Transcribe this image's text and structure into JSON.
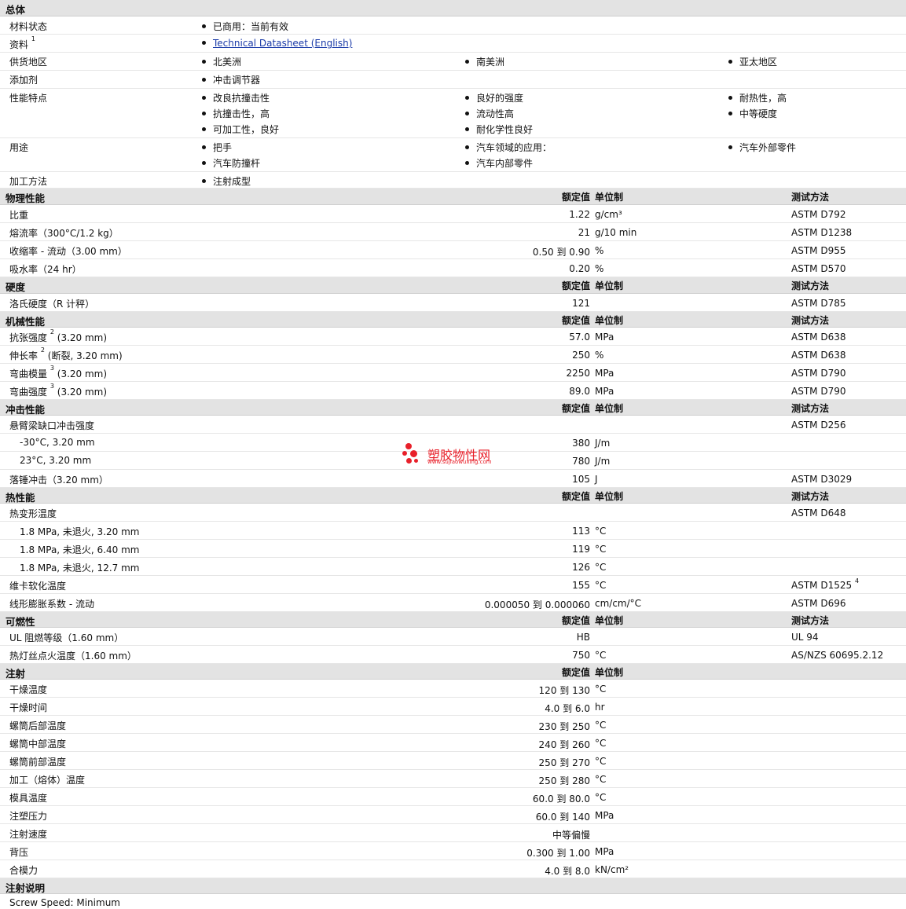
{
  "general": {
    "title": "总体",
    "status_label": "材料状态",
    "status_value": "已商用：当前有效",
    "docs_label": "资料",
    "docs_sup": "1",
    "docs_link": "Technical Datasheet (English)",
    "region_label": "供货地区",
    "regions": [
      "北美洲",
      "南美洲",
      "亚太地区"
    ],
    "additive_label": "添加剂",
    "additives": [
      "冲击调节器"
    ],
    "features_label": "性能特点",
    "features": [
      "改良抗撞击性",
      "良好的强度",
      "耐热性，高",
      "抗撞击性，高",
      "流动性高",
      "中等硬度",
      "可加工性，良好",
      "耐化学性良好"
    ],
    "uses_label": "用途",
    "uses": [
      "把手",
      "汽车领域的应用：",
      "汽车外部零件",
      "汽车防撞杆",
      "汽车内部零件"
    ],
    "process_label": "加工方法",
    "process": [
      "注射成型"
    ]
  },
  "headers": {
    "value": "额定值",
    "unit": "单位制",
    "method": "测试方法"
  },
  "physical": {
    "title": "物理性能",
    "rows": [
      {
        "label": "比重",
        "value": "1.22",
        "unit": "g/cm³",
        "method": "ASTM D792"
      },
      {
        "label": "熔流率（300°C/1.2 kg）",
        "value": "21",
        "unit": "g/10 min",
        "method": "ASTM D1238"
      },
      {
        "label": "收缩率 - 流动（3.00 mm）",
        "value": "0.50 到  0.90",
        "unit": "%",
        "method": "ASTM D955"
      },
      {
        "label": "吸水率（24 hr）",
        "value": "0.20",
        "unit": "%",
        "method": "ASTM D570"
      }
    ]
  },
  "hardness": {
    "title": "硬度",
    "rows": [
      {
        "label": "洛氏硬度（R 计秤）",
        "value": "121",
        "unit": "",
        "method": "ASTM D785"
      }
    ]
  },
  "mechanical": {
    "title": "机械性能",
    "rows": [
      {
        "label": "抗张强度",
        "sup": "2",
        "label2": "(3.20 mm)",
        "value": "57.0",
        "unit": "MPa",
        "method": "ASTM D638"
      },
      {
        "label": "伸长率",
        "sup": "2",
        "label2": "(断裂, 3.20 mm)",
        "value": "250",
        "unit": "%",
        "method": "ASTM D638"
      },
      {
        "label": "弯曲模量",
        "sup": "3",
        "label2": "(3.20 mm)",
        "value": "2250",
        "unit": "MPa",
        "method": "ASTM D790"
      },
      {
        "label": "弯曲强度",
        "sup": "3",
        "label2": "(3.20 mm)",
        "value": "89.0",
        "unit": "MPa",
        "method": "ASTM D790"
      }
    ]
  },
  "impact": {
    "title": "冲击性能",
    "rows": [
      {
        "label": "悬臂梁缺口冲击强度",
        "value": "",
        "unit": "",
        "method": "ASTM D256"
      },
      {
        "label": "-30°C, 3.20 mm",
        "value": "380",
        "unit": "J/m",
        "method": "",
        "sub": true
      },
      {
        "label": "23°C, 3.20 mm",
        "value": "780",
        "unit": "J/m",
        "method": "",
        "sub": true
      },
      {
        "label": "落锤冲击（3.20 mm）",
        "value": "105",
        "unit": "J",
        "method": "ASTM D3029"
      }
    ]
  },
  "thermal": {
    "title": "热性能",
    "rows": [
      {
        "label": "热变形温度",
        "value": "",
        "unit": "",
        "method": "ASTM D648"
      },
      {
        "label": "1.8 MPa, 未退火, 3.20 mm",
        "value": "113",
        "unit": "°C",
        "method": "",
        "sub": true
      },
      {
        "label": "1.8 MPa, 未退火, 6.40 mm",
        "value": "119",
        "unit": "°C",
        "method": "",
        "sub": true
      },
      {
        "label": "1.8 MPa, 未退火, 12.7 mm",
        "value": "126",
        "unit": "°C",
        "method": "",
        "sub": true
      },
      {
        "label": "维卡软化温度",
        "value": "155",
        "unit": "°C",
        "method": "ASTM D1525",
        "msup": "4"
      },
      {
        "label": "线形膨胀系数 - 流动",
        "value": "0.000050 到  0.000060",
        "unit": "cm/cm/°C",
        "method": "ASTM D696"
      }
    ]
  },
  "flammability": {
    "title": "可燃性",
    "rows": [
      {
        "label": "UL 阻燃等级（1.60 mm）",
        "value": "HB",
        "unit": "",
        "method": "UL 94"
      },
      {
        "label": "热灯丝点火温度（1.60 mm）",
        "value": "750",
        "unit": "°C",
        "method": "AS/NZS 60695.2.12"
      }
    ]
  },
  "injection": {
    "title": "注射",
    "rows": [
      {
        "label": "干燥温度",
        "value": "120 到  130",
        "unit": "°C"
      },
      {
        "label": "干燥时间",
        "value": "4.0 到  6.0",
        "unit": "hr"
      },
      {
        "label": "螺筒后部温度",
        "value": "230 到  250",
        "unit": "°C"
      },
      {
        "label": "螺筒中部温度",
        "value": "240 到  260",
        "unit": "°C"
      },
      {
        "label": "螺筒前部温度",
        "value": "250 到  270",
        "unit": "°C"
      },
      {
        "label": "加工（熔体）温度",
        "value": "250 到  280",
        "unit": "°C"
      },
      {
        "label": "模具温度",
        "value": "60.0 到  80.0",
        "unit": "°C"
      },
      {
        "label": "注塑压力",
        "value": "60.0 到  140",
        "unit": "MPa"
      },
      {
        "label": "注射速度",
        "value": "中等偏慢",
        "unit": ""
      },
      {
        "label": "背压",
        "value": "0.300 到  1.00",
        "unit": "MPa"
      },
      {
        "label": "合模力",
        "value": "4.0 到  8.0",
        "unit": "kN/cm²"
      }
    ]
  },
  "injection_notes": {
    "title": "注射说明",
    "text": "Screw Speed: Minimum"
  },
  "watermark": {
    "text": "塑胶物性网",
    "url": "www.sujiaowuxing.com",
    "color": "#e8202a"
  }
}
